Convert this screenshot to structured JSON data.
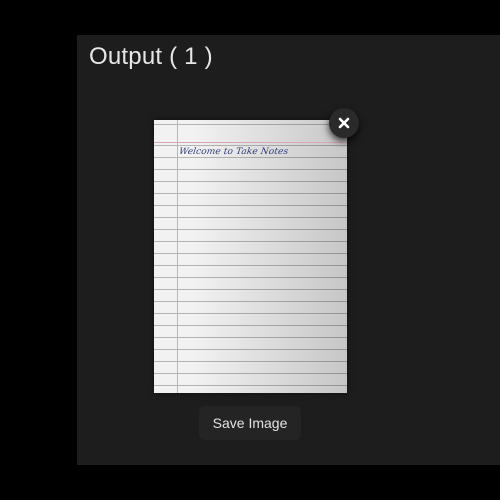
{
  "output_panel": {
    "title": "Output ( 1 )",
    "note": {
      "handwritten_text": "Welcome to Take Notes"
    },
    "close_icon": "close-icon",
    "save_label": "Save Image"
  },
  "colors": {
    "page_background": "#000000",
    "panel_background": "#1d1d1d",
    "paper": "#f2f2f2",
    "rule_line": "#b4b4b4",
    "margin_line": "#d9a4b6",
    "ink": "#2b3b7a",
    "text": "#e6e6e6"
  }
}
